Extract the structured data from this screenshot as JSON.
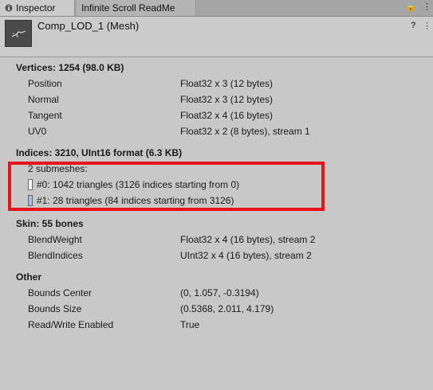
{
  "tabs": {
    "inspector": "Inspector",
    "readme": "Infinite Scroll ReadMe",
    "lock_glyph": "🔓",
    "menu_glyph": "⋮"
  },
  "header": {
    "title": "Comp_LOD_1 (Mesh)",
    "help_glyph": "?",
    "menu_glyph": "⋮"
  },
  "vertices": {
    "title": "Vertices: 1254 (98.0 KB)",
    "rows": [
      {
        "label": "Position",
        "value": "Float32 x 3 (12 bytes)"
      },
      {
        "label": "Normal",
        "value": "Float32 x 3 (12 bytes)"
      },
      {
        "label": "Tangent",
        "value": "Float32 x 4 (16 bytes)"
      },
      {
        "label": "UV0",
        "value": "Float32 x 2 (8 bytes), stream 1"
      }
    ]
  },
  "indices": {
    "title": "Indices: 3210, UInt16 format (6.3 KB)",
    "submeshes_label": "2 submeshes:",
    "submeshes": [
      {
        "text": "#0: 1042 triangles (3126 indices starting from 0)",
        "color": "#ffffff"
      },
      {
        "text": "#1: 28 triangles (84 indices starting from 3126)",
        "color": "#a8b8f0"
      }
    ],
    "highlight_color": "#e4141a"
  },
  "skin": {
    "title": "Skin: 55 bones",
    "rows": [
      {
        "label": "BlendWeight",
        "value": "Float32 x 4 (16 bytes), stream 2"
      },
      {
        "label": "BlendIndices",
        "value": "UInt32 x 4 (16 bytes), stream 2"
      }
    ]
  },
  "other": {
    "title": "Other",
    "rows": [
      {
        "label": "Bounds Center",
        "value": "(0, 1.057, -0.3194)"
      },
      {
        "label": "Bounds Size",
        "value": "(0.5368, 2.011, 4.179)"
      },
      {
        "label": "Read/Write Enabled",
        "value": "True"
      }
    ]
  }
}
